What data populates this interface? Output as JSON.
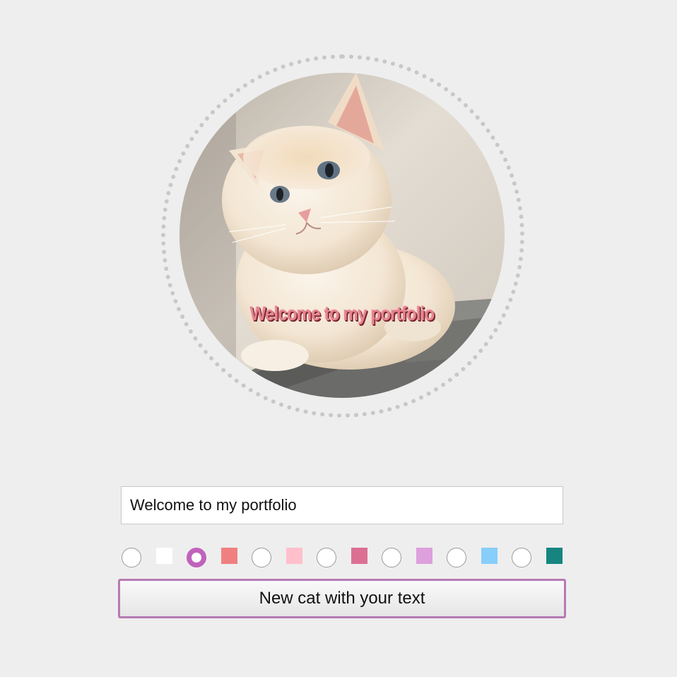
{
  "banner": {
    "caption": "Welcome to my portfolio"
  },
  "form": {
    "text_value": "Welcome to my portfolio",
    "button_label": "New cat with your text",
    "colors": [
      {
        "name": "white",
        "hex": "#ffffff",
        "control": "radio",
        "checked": false
      },
      {
        "name": "white",
        "hex": "#ffffff",
        "control": "swatch"
      },
      {
        "name": "orchid",
        "hex": "#c062bd",
        "control": "radio",
        "checked": true
      },
      {
        "name": "light-coral",
        "hex": "#f08080",
        "control": "swatch"
      },
      {
        "name": "light-coral",
        "hex": "#f08080",
        "control": "radio",
        "checked": false
      },
      {
        "name": "pink",
        "hex": "#ffc0cb",
        "control": "swatch"
      },
      {
        "name": "pink",
        "hex": "#ffc0cb",
        "control": "radio",
        "checked": false
      },
      {
        "name": "pale-violet-red",
        "hex": "#db7093",
        "control": "swatch"
      },
      {
        "name": "pale-violet-red",
        "hex": "#db7093",
        "control": "radio",
        "checked": false
      },
      {
        "name": "plum",
        "hex": "#dda0dd",
        "control": "swatch"
      },
      {
        "name": "plum",
        "hex": "#dda0dd",
        "control": "radio",
        "checked": false
      },
      {
        "name": "light-sky-blue",
        "hex": "#87cefa",
        "control": "swatch"
      },
      {
        "name": "light-sky-blue",
        "hex": "#87cefa",
        "control": "radio",
        "checked": false
      },
      {
        "name": "teal",
        "hex": "#168580",
        "control": "swatch"
      }
    ]
  },
  "theme": {
    "background": "#eeeeee",
    "accent": "#c062bd",
    "caption_color": "#e48590"
  }
}
